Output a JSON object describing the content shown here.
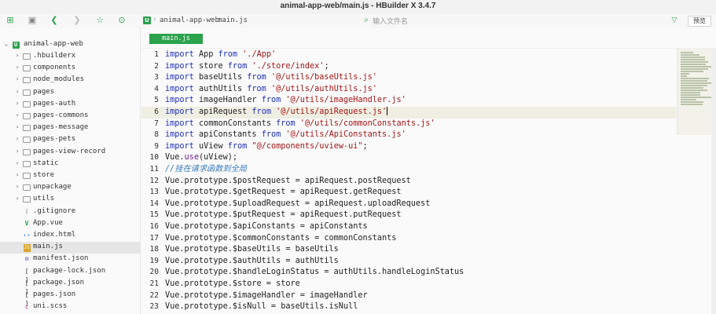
{
  "window": {
    "title": "animal-app-web/main.js - HBuilder X 3.4.7"
  },
  "toolbar": {
    "icons": [
      "new-file-icon",
      "save-icon",
      "back-icon",
      "forward-icon",
      "star-icon",
      "run-icon"
    ],
    "breadcrumb": [
      "animal-app-web",
      "main.js"
    ],
    "search_placeholder": "输入文件名",
    "preview_label": "预览"
  },
  "sidebar": {
    "project": "animal-app-web",
    "items": [
      {
        "label": ".hbuilderx",
        "type": "folder"
      },
      {
        "label": "components",
        "type": "folder"
      },
      {
        "label": "node_modules",
        "type": "folder"
      },
      {
        "label": "pages",
        "type": "folder"
      },
      {
        "label": "pages-auth",
        "type": "folder"
      },
      {
        "label": "pages-commons",
        "type": "folder"
      },
      {
        "label": "pages-message",
        "type": "folder"
      },
      {
        "label": "pages-pets",
        "type": "folder"
      },
      {
        "label": "pages-view-record",
        "type": "folder"
      },
      {
        "label": "static",
        "type": "folder"
      },
      {
        "label": "store",
        "type": "folder"
      },
      {
        "label": "unpackage",
        "type": "folder"
      },
      {
        "label": "utils",
        "type": "folder"
      },
      {
        "label": ".gitignore",
        "type": "git"
      },
      {
        "label": "App.vue",
        "type": "vue"
      },
      {
        "label": "index.html",
        "type": "html"
      },
      {
        "label": "main.js",
        "type": "js",
        "selected": true
      },
      {
        "label": "manifest.json",
        "type": "manifest"
      },
      {
        "label": "package-lock.json",
        "type": "json"
      },
      {
        "label": "package.json",
        "type": "json"
      },
      {
        "label": "pages.json",
        "type": "json"
      },
      {
        "label": "uni.scss",
        "type": "scss"
      }
    ]
  },
  "editor": {
    "active_tab": "main.js",
    "current_line": 6,
    "lines": [
      "import App from './App'",
      "import store from './store/index';",
      "import baseUtils from '@/utils/baseUtils.js'",
      "import authUtils from '@/utils/authUtils.js'",
      "import imageHandler from '@/utils/imageHandler.js'",
      "import apiRequest from '@/utils/apiRequest.js'",
      "import commonConstants from '@/utils/commonConstants.js'",
      "import apiConstants from '@/utils/ApiConstants.js'",
      "import uView from \"@/components/uview-ui\";",
      "Vue.use(uView);",
      "//挂在请求函数到全局",
      "Vue.prototype.$postRequest = apiRequest.postRequest",
      "Vue.prototype.$getRequest = apiRequest.getRequest",
      "Vue.prototype.$uploadRequest = apiRequest.uploadRequest",
      "Vue.prototype.$putRequest = apiRequest.putRequest",
      "Vue.prototype.$apiConstants = apiConstants",
      "Vue.prototype.$commonConstants = commonConstants",
      "Vue.prototype.$baseUtils = baseUtils",
      "Vue.prototype.$authUtils = authUtils",
      "Vue.prototype.$handleLoginStatus = authUtils.handleLoginStatus",
      "Vue.prototype.$store = store",
      "Vue.prototype.$imageHandler = imageHandler",
      "Vue.prototype.$isNull = baseUtils.isNull"
    ]
  },
  "colors": {
    "accent": "#2ba24c",
    "keyword": "#1d2fb5",
    "string": "#a31515",
    "comment": "#3a7dbd",
    "current_line_bg": "#efeee2"
  }
}
